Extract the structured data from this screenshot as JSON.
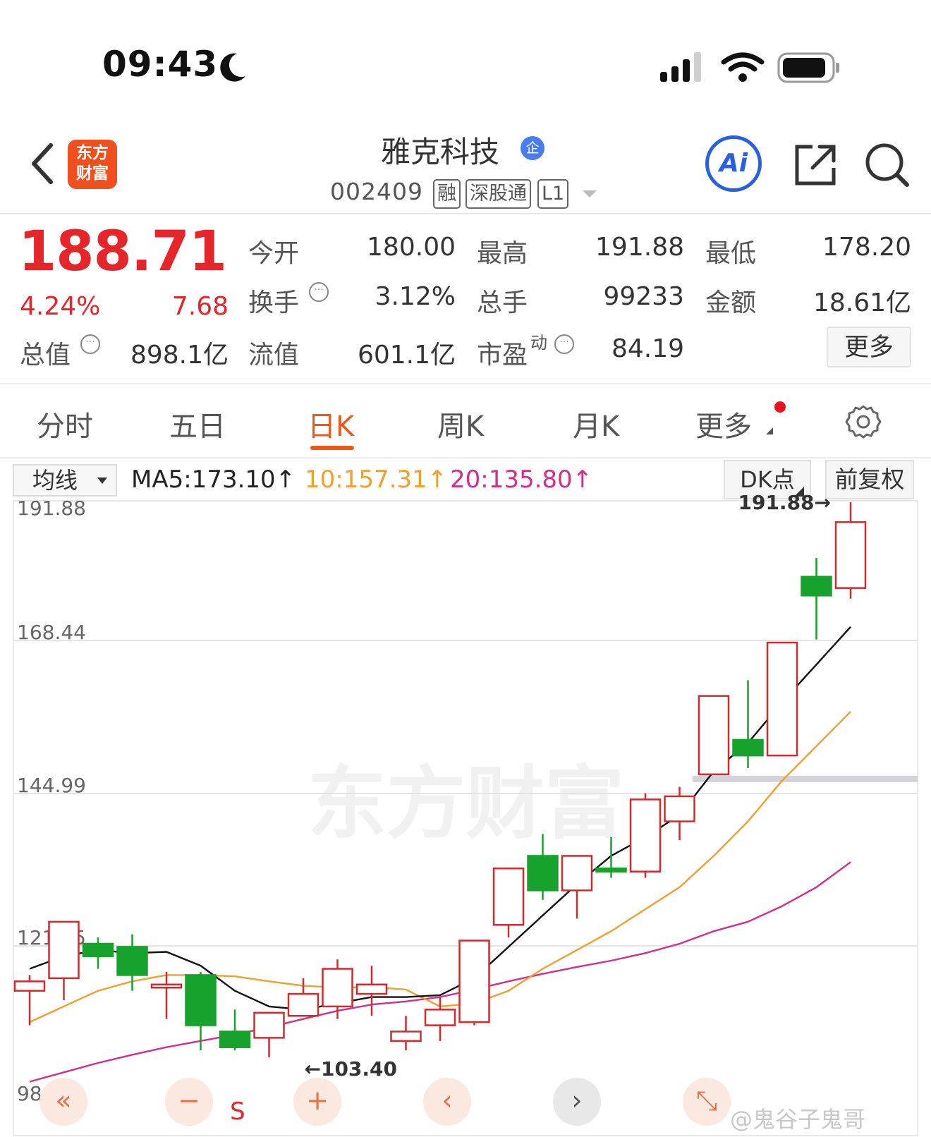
{
  "status_bar": {
    "time": "09:43"
  },
  "header": {
    "logo_line1": "东方",
    "logo_line2": "财富",
    "title": "雅克科技",
    "title_badge": "企",
    "code": "002409",
    "tags": [
      "融",
      "深股通",
      "L1"
    ],
    "ai_label": "Ai"
  },
  "quote": {
    "price": "188.71",
    "change_pct": "4.24%",
    "change": "7.68",
    "fields": [
      {
        "label": "今开",
        "value": "180.00"
      },
      {
        "label": "最高",
        "value": "191.88"
      },
      {
        "label": "最低",
        "value": "178.20"
      },
      {
        "label": "换手",
        "value": "3.12%"
      },
      {
        "label": "总手",
        "value": "99233"
      },
      {
        "label": "金额",
        "value": "18.61亿"
      },
      {
        "label": "总值",
        "value": "898.1亿"
      },
      {
        "label": "流值",
        "value": "601.1亿"
      },
      {
        "label": "市盈",
        "label_sup": "动",
        "value": "84.19"
      }
    ],
    "more_label": "更多"
  },
  "tabs": [
    {
      "label": "分时",
      "active": false
    },
    {
      "label": "五日",
      "active": false
    },
    {
      "label": "日K",
      "active": true
    },
    {
      "label": "周K",
      "active": false
    },
    {
      "label": "月K",
      "active": false
    },
    {
      "label": "更多",
      "active": false
    }
  ],
  "ma_bar": {
    "select_label": "均线",
    "ma5": "MA5:173.10↑",
    "ma10": "10:157.31↑",
    "ma20": "20:135.80↑",
    "dk_label": "DK点",
    "adjust_label": "前复权"
  },
  "colors": {
    "up": "#d12b2f",
    "down": "#16a22c",
    "ma5": "#111111",
    "ma10": "#f0a030",
    "ma20": "#d0308a",
    "accent": "#ec5a1a"
  },
  "chart_data": {
    "type": "candlestick",
    "y_ticks": [
      "191.88",
      "168.44",
      "144.99",
      "121.55",
      "98.11"
    ],
    "ylim": [
      98.11,
      191.88
    ],
    "high_label": "191.88→",
    "low_label": "←103.40",
    "support_level": 148.5,
    "watermark": "东方财富",
    "signal": "S",
    "candles": [
      {
        "o": 114.0,
        "h": 116.5,
        "l": 108.5,
        "c": 115.5
      },
      {
        "o": 116.0,
        "h": 125.0,
        "l": 112.5,
        "c": 125.0
      },
      {
        "o": 121.5,
        "h": 122.5,
        "l": 117.5,
        "c": 119.5
      },
      {
        "o": 121.0,
        "h": 123.0,
        "l": 114.0,
        "c": 116.5
      },
      {
        "o": 114.5,
        "h": 117.0,
        "l": 109.5,
        "c": 115.0
      },
      {
        "o": 116.5,
        "h": 117.0,
        "l": 104.5,
        "c": 108.5
      },
      {
        "o": 107.5,
        "h": 111.0,
        "l": 104.5,
        "c": 105.0
      },
      {
        "o": 106.5,
        "h": 110.5,
        "l": 103.4,
        "c": 110.5
      },
      {
        "o": 110.0,
        "h": 116.0,
        "l": 110.0,
        "c": 113.5
      },
      {
        "o": 111.5,
        "h": 119.0,
        "l": 109.5,
        "c": 117.5
      },
      {
        "o": 113.5,
        "h": 118.0,
        "l": 110.0,
        "c": 115.0
      },
      {
        "o": 106.0,
        "h": 110.0,
        "l": 104.5,
        "c": 107.5
      },
      {
        "o": 108.5,
        "h": 113.0,
        "l": 106.0,
        "c": 111.0
      },
      {
        "o": 109.0,
        "h": 122.0,
        "l": 108.5,
        "c": 122.0
      },
      {
        "o": 124.5,
        "h": 133.5,
        "l": 122.5,
        "c": 133.5
      },
      {
        "o": 135.5,
        "h": 139.0,
        "l": 128.5,
        "c": 130.0
      },
      {
        "o": 130.0,
        "h": 135.5,
        "l": 125.5,
        "c": 135.5
      },
      {
        "o": 133.5,
        "h": 138.5,
        "l": 132.0,
        "c": 133.0
      },
      {
        "o": 133.0,
        "h": 145.5,
        "l": 132.0,
        "c": 144.5
      },
      {
        "o": 141.0,
        "h": 146.5,
        "l": 138.0,
        "c": 145.0
      },
      {
        "o": 148.5,
        "h": 161.0,
        "l": 148.5,
        "c": 161.0
      },
      {
        "o": 154.0,
        "h": 163.5,
        "l": 149.5,
        "c": 151.5
      },
      {
        "o": 151.5,
        "h": 169.5,
        "l": 151.5,
        "c": 169.5
      },
      {
        "o": 180.0,
        "h": 183.0,
        "l": 170.0,
        "c": 177.0
      },
      {
        "o": 178.2,
        "h": 191.88,
        "l": 176.5,
        "c": 188.71
      }
    ],
    "ma5": [
      117.5,
      119.5,
      120.5,
      120.0,
      120.2,
      118.0,
      114.0,
      111.5,
      111.0,
      112.0,
      113.0,
      113.0,
      113.3,
      116.0,
      121.0,
      126.0,
      131.0,
      135.5,
      138.5,
      142.0,
      149.0,
      153.5,
      160.0,
      166.0,
      172.0
    ],
    "ma10": [
      109.0,
      111.5,
      114.0,
      115.5,
      116.5,
      116.5,
      116.3,
      115.5,
      114.8,
      114.5,
      114.6,
      114.2,
      111.5,
      112.0,
      114.0,
      117.5,
      120.5,
      123.5,
      127.0,
      130.5,
      135.5,
      141.0,
      147.5,
      153.0,
      158.5
    ],
    "ma20": [
      99.5,
      101.0,
      102.5,
      103.8,
      105.0,
      106.0,
      107.0,
      108.2,
      109.5,
      110.8,
      111.8,
      112.3,
      113.0,
      114.2,
      115.5,
      116.7,
      117.8,
      118.8,
      120.0,
      121.5,
      123.5,
      125.0,
      127.5,
      130.5,
      134.5
    ]
  },
  "watermark_bottom": "@鬼谷子鬼哥"
}
